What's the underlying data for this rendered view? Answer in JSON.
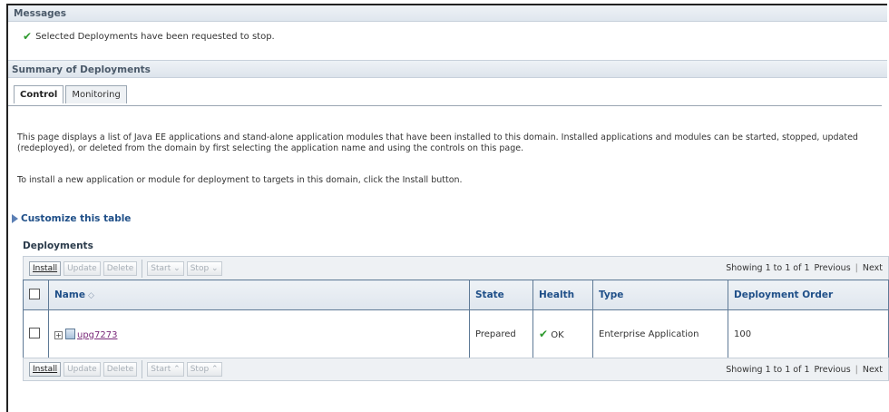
{
  "messages": {
    "heading": "Messages",
    "text": "Selected Deployments have been requested to stop."
  },
  "summary": {
    "heading": "Summary of Deployments",
    "tabs": [
      "Control",
      "Monitoring"
    ],
    "description": "This page displays a list of Java EE applications and stand-alone application modules that have been installed to this domain. Installed applications and modules can be started, stopped, updated (redeployed), or deleted from the domain by first selecting the application name and using the controls on this page.",
    "install_hint": "To install a new application or module for deployment to targets in this domain, click the Install button."
  },
  "customize": {
    "label": "Customize this table"
  },
  "deployments": {
    "title": "Deployments",
    "toolbar": {
      "install": "Install",
      "update": "Update",
      "delete": "Delete",
      "start": "Start",
      "stop": "Stop"
    },
    "paging": {
      "showing": "Showing 1 to 1 of 1",
      "previous": "Previous",
      "next": "Next"
    },
    "columns": [
      "Name",
      "State",
      "Health",
      "Type",
      "Deployment Order"
    ],
    "rows": [
      {
        "name": "upg7273",
        "state": "Prepared",
        "health": "OK",
        "type": "Enterprise Application",
        "order": "100"
      }
    ]
  }
}
